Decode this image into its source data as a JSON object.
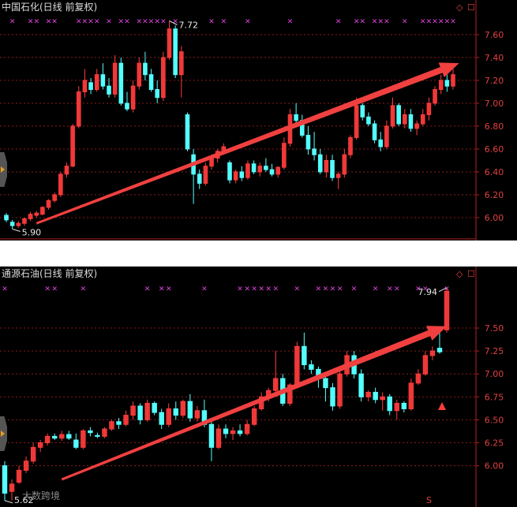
{
  "panels": [
    {
      "title": "中国石化(日线 前复权)",
      "marks": {
        "high": "7.72",
        "low": "5.90"
      },
      "y_ticks": [
        "7.60",
        "7.40",
        "7.20",
        "7.00",
        "6.80",
        "6.60",
        "6.40",
        "6.20",
        "6.00"
      ]
    },
    {
      "title": "通源石油(日线 前复权)",
      "marks": {
        "high": "7.94",
        "low": "5.62"
      },
      "y_ticks": [
        "7.50",
        "7.25",
        "7.00",
        "6.75",
        "6.50",
        "6.25",
        "6.00"
      ]
    }
  ],
  "watermark": "大数跨境",
  "bottom_signal": "S",
  "colors": {
    "up": "#ff3c3c",
    "down": "#54ffff",
    "arrow": "#f04040",
    "marker": "#e040e0",
    "grid": "#8b1a1a"
  },
  "chart_data": [
    {
      "type": "candlestick",
      "title": "中国石化(日线 前复权)",
      "ylim": [
        5.8,
        7.82
      ],
      "annotations": [
        {
          "text": "7.72",
          "type": "high"
        },
        {
          "text": "5.90",
          "type": "low"
        }
      ],
      "trend_arrow": {
        "from": [
          5,
          5.95
        ],
        "to": [
          75,
          7.35
        ]
      },
      "ohlc": [
        [
          6.02,
          6.04,
          5.96,
          5.98
        ],
        [
          5.96,
          5.98,
          5.9,
          5.93
        ],
        [
          5.93,
          5.97,
          5.91,
          5.95
        ],
        [
          5.95,
          6.0,
          5.93,
          5.99
        ],
        [
          5.99,
          6.05,
          5.97,
          6.03
        ],
        [
          6.02,
          6.06,
          6.0,
          6.04
        ],
        [
          6.03,
          6.1,
          6.02,
          6.09
        ],
        [
          6.09,
          6.16,
          6.07,
          6.15
        ],
        [
          6.15,
          6.22,
          6.13,
          6.2
        ],
        [
          6.2,
          6.4,
          6.18,
          6.38
        ],
        [
          6.38,
          6.48,
          6.35,
          6.45
        ],
        [
          6.45,
          6.82,
          6.44,
          6.8
        ],
        [
          6.8,
          7.15,
          6.78,
          7.1
        ],
        [
          7.1,
          7.3,
          7.05,
          7.2
        ],
        [
          7.18,
          7.22,
          7.08,
          7.12
        ],
        [
          7.12,
          7.3,
          7.1,
          7.25
        ],
        [
          7.25,
          7.35,
          7.12,
          7.15
        ],
        [
          7.15,
          7.22,
          7.05,
          7.08
        ],
        [
          7.08,
          7.42,
          7.05,
          7.35
        ],
        [
          7.35,
          7.4,
          6.98,
          7.0
        ],
        [
          7.0,
          7.1,
          6.93,
          6.95
        ],
        [
          6.95,
          7.2,
          6.92,
          7.15
        ],
        [
          7.15,
          7.4,
          7.12,
          7.35
        ],
        [
          7.35,
          7.45,
          7.2,
          7.25
        ],
        [
          7.25,
          7.3,
          7.1,
          7.12
        ],
        [
          7.12,
          7.2,
          7.0,
          7.05
        ],
        [
          7.05,
          7.45,
          7.02,
          7.4
        ],
        [
          7.4,
          7.72,
          7.38,
          7.65
        ],
        [
          7.65,
          7.68,
          7.22,
          7.25
        ],
        [
          7.25,
          7.5,
          7.05,
          7.45
        ],
        [
          6.9,
          6.92,
          6.58,
          6.6
        ],
        [
          6.55,
          6.6,
          6.12,
          6.38
        ],
        [
          6.38,
          6.42,
          6.25,
          6.3
        ],
        [
          6.3,
          6.48,
          6.28,
          6.45
        ],
        [
          6.45,
          6.55,
          6.42,
          6.52
        ],
        [
          6.52,
          6.6,
          6.48,
          6.58
        ],
        [
          6.58,
          6.65,
          6.55,
          6.62
        ],
        [
          6.48,
          6.5,
          6.3,
          6.33
        ],
        [
          6.33,
          6.42,
          6.3,
          6.4
        ],
        [
          6.4,
          6.45,
          6.32,
          6.35
        ],
        [
          6.35,
          6.5,
          6.33,
          6.47
        ],
        [
          6.47,
          6.5,
          6.38,
          6.4
        ],
        [
          6.4,
          6.48,
          6.36,
          6.45
        ],
        [
          6.45,
          6.52,
          6.4,
          6.42
        ],
        [
          6.42,
          6.47,
          6.36,
          6.38
        ],
        [
          6.38,
          6.45,
          6.35,
          6.44
        ],
        [
          6.44,
          6.7,
          6.42,
          6.65
        ],
        [
          6.65,
          6.95,
          6.62,
          6.9
        ],
        [
          6.9,
          7.0,
          6.8,
          6.85
        ],
        [
          6.85,
          6.9,
          6.7,
          6.72
        ],
        [
          6.72,
          6.8,
          6.55,
          6.6
        ],
        [
          6.6,
          6.75,
          6.5,
          6.55
        ],
        [
          6.55,
          6.6,
          6.38,
          6.4
        ],
        [
          6.4,
          6.55,
          6.35,
          6.5
        ],
        [
          6.5,
          6.55,
          6.32,
          6.35
        ],
        [
          6.35,
          6.4,
          6.25,
          6.38
        ],
        [
          6.38,
          6.6,
          6.35,
          6.55
        ],
        [
          6.55,
          6.72,
          6.52,
          6.7
        ],
        [
          6.7,
          7.05,
          6.68,
          6.98
        ],
        [
          6.98,
          7.0,
          6.85,
          6.88
        ],
        [
          6.88,
          6.92,
          6.8,
          6.82
        ],
        [
          6.82,
          6.85,
          6.65,
          6.68
        ],
        [
          6.68,
          6.75,
          6.58,
          6.62
        ],
        [
          6.62,
          6.85,
          6.6,
          6.8
        ],
        [
          6.8,
          7.05,
          6.78,
          6.98
        ],
        [
          6.98,
          7.0,
          6.8,
          6.82
        ],
        [
          6.82,
          6.95,
          6.78,
          6.9
        ],
        [
          6.9,
          6.95,
          6.75,
          6.78
        ],
        [
          6.78,
          6.85,
          6.72,
          6.82
        ],
        [
          6.82,
          6.95,
          6.8,
          6.9
        ],
        [
          6.9,
          7.05,
          6.85,
          7.0
        ],
        [
          7.0,
          7.15,
          6.98,
          7.12
        ],
        [
          7.12,
          7.25,
          7.08,
          7.2
        ],
        [
          7.2,
          7.25,
          7.1,
          7.15
        ],
        [
          7.15,
          7.3,
          7.12,
          7.25
        ]
      ]
    },
    {
      "type": "candlestick",
      "title": "通源石油(日线 前复权)",
      "ylim": [
        5.55,
        8.05
      ],
      "annotations": [
        {
          "text": "7.94",
          "type": "high"
        },
        {
          "text": "5.62",
          "type": "low"
        }
      ],
      "trend_arrow": {
        "from": [
          8,
          5.85
        ],
        "to": [
          62,
          7.52
        ]
      },
      "ohlc": [
        [
          6.0,
          6.05,
          5.62,
          5.7
        ],
        [
          5.72,
          5.85,
          5.62,
          5.8
        ],
        [
          5.82,
          6.0,
          5.8,
          5.95
        ],
        [
          5.95,
          6.1,
          5.92,
          6.05
        ],
        [
          6.05,
          6.25,
          6.02,
          6.2
        ],
        [
          6.2,
          6.28,
          6.15,
          6.25
        ],
        [
          6.25,
          6.35,
          6.22,
          6.32
        ],
        [
          6.32,
          6.35,
          6.28,
          6.3
        ],
        [
          6.3,
          6.38,
          6.27,
          6.34
        ],
        [
          6.34,
          6.38,
          6.28,
          6.3
        ],
        [
          6.28,
          6.35,
          6.18,
          6.2
        ],
        [
          6.2,
          6.4,
          6.18,
          6.38
        ],
        [
          6.38,
          6.42,
          6.32,
          6.36
        ],
        [
          6.33,
          6.36,
          6.3,
          6.32
        ],
        [
          6.32,
          6.42,
          6.3,
          6.4
        ],
        [
          6.4,
          6.5,
          6.38,
          6.48
        ],
        [
          6.48,
          6.52,
          6.4,
          6.45
        ],
        [
          6.45,
          6.6,
          6.43,
          6.55
        ],
        [
          6.55,
          6.7,
          6.5,
          6.65
        ],
        [
          6.65,
          6.68,
          6.45,
          6.5
        ],
        [
          6.5,
          6.72,
          6.48,
          6.68
        ],
        [
          6.68,
          6.7,
          6.55,
          6.58
        ],
        [
          6.58,
          6.62,
          6.4,
          6.45
        ],
        [
          6.45,
          6.68,
          6.42,
          6.62
        ],
        [
          6.62,
          6.7,
          6.5,
          6.55
        ],
        [
          6.55,
          6.72,
          6.52,
          6.7
        ],
        [
          6.7,
          6.78,
          6.48,
          6.52
        ],
        [
          6.52,
          6.65,
          6.48,
          6.6
        ],
        [
          6.6,
          6.72,
          6.42,
          6.45
        ],
        [
          6.45,
          6.5,
          6.05,
          6.2
        ],
        [
          6.2,
          6.45,
          6.18,
          6.4
        ],
        [
          6.4,
          6.45,
          6.3,
          6.35
        ],
        [
          6.35,
          6.42,
          6.28,
          6.38
        ],
        [
          6.38,
          6.45,
          6.32,
          6.35
        ],
        [
          6.35,
          6.5,
          6.33,
          6.45
        ],
        [
          6.45,
          6.65,
          6.43,
          6.62
        ],
        [
          6.62,
          6.8,
          6.6,
          6.75
        ],
        [
          6.75,
          6.85,
          6.7,
          6.82
        ],
        [
          6.82,
          7.25,
          6.8,
          6.95
        ],
        [
          6.95,
          7.0,
          6.65,
          6.68
        ],
        [
          6.68,
          6.9,
          6.65,
          6.88
        ],
        [
          6.88,
          7.35,
          6.85,
          7.3
        ],
        [
          7.3,
          7.45,
          7.05,
          7.1
        ],
        [
          7.1,
          7.15,
          7.0,
          7.05
        ],
        [
          7.05,
          7.08,
          6.85,
          6.95
        ],
        [
          6.95,
          7.0,
          6.7,
          6.85
        ],
        [
          6.85,
          6.9,
          6.6,
          6.65
        ],
        [
          6.65,
          7.05,
          6.62,
          7.0
        ],
        [
          7.0,
          7.25,
          6.97,
          7.2
        ],
        [
          7.2,
          7.25,
          6.95,
          7.0
        ],
        [
          7.0,
          7.05,
          6.7,
          6.75
        ],
        [
          6.75,
          6.82,
          6.7,
          6.8
        ],
        [
          6.8,
          6.85,
          6.68,
          6.72
        ],
        [
          6.72,
          6.8,
          6.6,
          6.75
        ],
        [
          6.75,
          6.78,
          6.55,
          6.6
        ],
        [
          6.6,
          6.72,
          6.5,
          6.68
        ],
        [
          6.68,
          6.7,
          6.58,
          6.62
        ],
        [
          6.62,
          6.95,
          6.6,
          6.9
        ],
        [
          6.9,
          7.05,
          6.88,
          7.0
        ],
        [
          7.0,
          7.25,
          6.98,
          7.2
        ],
        [
          7.2,
          7.3,
          7.15,
          7.25
        ],
        [
          7.28,
          7.45,
          7.22,
          7.24
        ],
        [
          7.48,
          7.94,
          7.45,
          7.9
        ]
      ]
    }
  ]
}
